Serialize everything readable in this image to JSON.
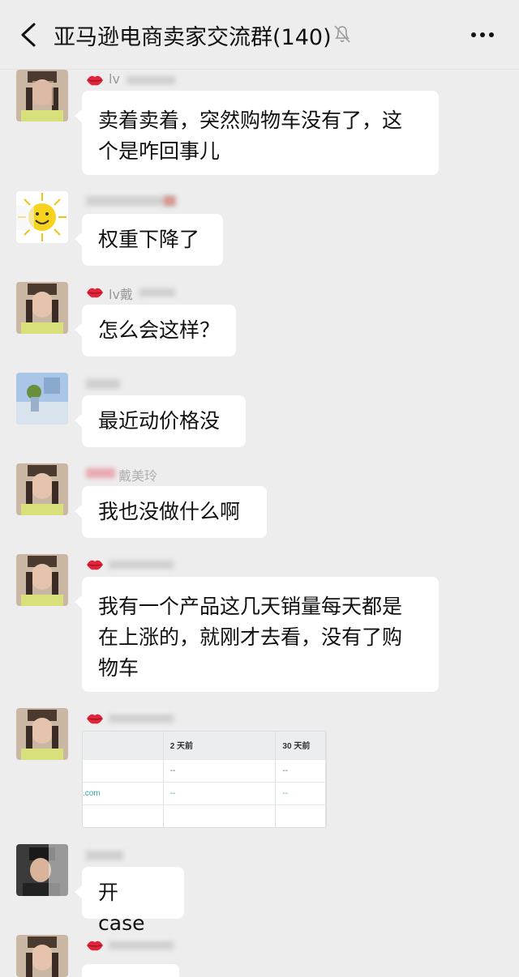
{
  "header": {
    "title": "亚马逊电商卖家交流群(140)",
    "back_icon": "chevron-left-icon",
    "mute_icon": "bell-off-icon",
    "more_icon": "more-icon"
  },
  "messages": [
    {
      "sender_visible": "lv",
      "avatar": "girl-photo",
      "lines": [
        "卖着卖着，突然购物车没有了，这",
        "个是咋回事儿"
      ]
    },
    {
      "sender_visible": "",
      "avatar": "sun-cartoon",
      "lines": [
        "权重下降了"
      ]
    },
    {
      "sender_visible": "lv戴",
      "avatar": "girl-photo",
      "lines": [
        "怎么会这样？"
      ]
    },
    {
      "sender_visible": "",
      "avatar": "landscape-photo",
      "lines": [
        "最近动价格没"
      ]
    },
    {
      "sender_visible": "戴美玲",
      "avatar": "girl-photo",
      "lines": [
        "我也没做什么啊"
      ]
    },
    {
      "sender_visible": "",
      "avatar": "girl-photo",
      "lines": [
        "我有一个产品这几天销量每天都是",
        "在上涨的，就刚才去看，没有了购",
        "物车"
      ]
    },
    {
      "sender_visible": "",
      "avatar": "girl-photo",
      "image_table": {
        "headers": [
          "",
          "2 天前",
          "30 天前"
        ],
        "rows": [
          [
            "",
            "--",
            "--"
          ],
          [
            ".com",
            "--",
            "--"
          ]
        ]
      }
    },
    {
      "sender_visible": "",
      "avatar": "man-photo",
      "lines": [
        "开 case"
      ]
    },
    {
      "sender_visible": "",
      "avatar": "girl-photo",
      "lines": []
    }
  ],
  "colors": {
    "background": "#ededed",
    "bubble": "#ffffff",
    "text": "#111111",
    "accent_red": "#e0263a"
  }
}
